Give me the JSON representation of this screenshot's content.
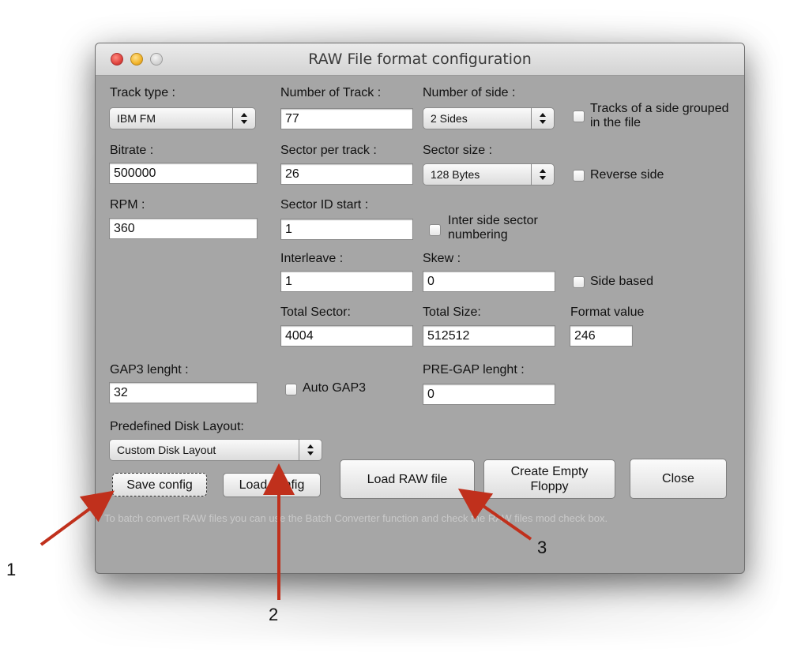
{
  "window": {
    "title": "RAW File format configuration"
  },
  "form": {
    "track_type_label": "Track type :",
    "track_type_value": "IBM FM",
    "number_of_track_label": "Number of Track :",
    "number_of_track_value": "77",
    "number_of_side_label": "Number of side :",
    "number_of_side_value": "2 Sides",
    "tracks_grouped_label": "Tracks of a side grouped in the file",
    "bitrate_label": "Bitrate :",
    "bitrate_value": "500000",
    "sector_per_track_label": "Sector per track :",
    "sector_per_track_value": "26",
    "sector_size_label": "Sector size :",
    "sector_size_value": "128 Bytes",
    "reverse_side_label": "Reverse side",
    "rpm_label": "RPM :",
    "rpm_value": "360",
    "sector_id_start_label": "Sector ID start :",
    "sector_id_start_value": "1",
    "inter_side_label": "Inter side sector numbering",
    "interleave_label": "Interleave :",
    "interleave_value": "1",
    "skew_label": "Skew :",
    "skew_value": "0",
    "side_based_label": "Side based",
    "total_sector_label": "Total Sector:",
    "total_sector_value": "4004",
    "total_size_label": "Total Size:",
    "total_size_value": "512512",
    "format_value_label": "Format value",
    "format_value_value": "246",
    "gap3_label": "GAP3 lenght :",
    "gap3_value": "32",
    "auto_gap3_label": "Auto GAP3",
    "pregap_label": "PRE-GAP lenght :",
    "pregap_value": "0",
    "predefined_layout_label": "Predefined Disk Layout:",
    "predefined_layout_value": "Custom Disk Layout"
  },
  "buttons": {
    "save_config": "Save config",
    "load_config": "Load config",
    "load_raw": "Load RAW file",
    "create_empty": "Create Empty Floppy",
    "close": "Close"
  },
  "hint": "To batch convert RAW files you can use the Batch Converter function and check the RAW files mod check box.",
  "annotations": {
    "n1": "1",
    "n2": "2",
    "n3": "3",
    "arrow_color": "#c0301c"
  }
}
